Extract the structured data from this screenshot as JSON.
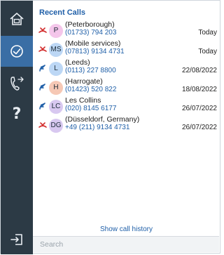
{
  "rail": {
    "items": [
      {
        "icon": "home-icon"
      },
      {
        "icon": "recent-calls-clock-icon",
        "active": true
      },
      {
        "icon": "transfer-phone-icon"
      },
      {
        "icon": "help-icon",
        "label": "?"
      },
      {
        "icon": "logout-icon"
      }
    ]
  },
  "recent": {
    "title": "Recent Calls",
    "calls": [
      {
        "direction": "missed",
        "initials": "P",
        "avatar_color": "#f4c6ea",
        "name": "(Peterborough)",
        "number": "(01733) 794 203",
        "date": "Today"
      },
      {
        "direction": "missed",
        "initials": "MS",
        "avatar_color": "#bcd7f5",
        "name": "(Mobile services)",
        "number": "(07813) 9134 4731",
        "date": "Today"
      },
      {
        "direction": "incoming",
        "initials": "L",
        "avatar_color": "#bcd7f5",
        "name": "(Leeds)",
        "number": "(0113) 227 8800",
        "date": "22/08/2022"
      },
      {
        "direction": "incoming",
        "initials": "H",
        "avatar_color": "#f6c8b5",
        "name": "(Harrogate)",
        "number": "(01423) 520 822",
        "date": "18/08/2022"
      },
      {
        "direction": "incoming",
        "initials": "LC",
        "avatar_color": "#d8c8f0",
        "name": "Les Collins",
        "number": "(020) 8145 6177",
        "date": "26/07/2022"
      },
      {
        "direction": "missed",
        "initials": "DG",
        "avatar_color": "#d8c8f0",
        "name": "(Düsseldorf, Germany)",
        "number": "+49 (211) 9134 4731",
        "date": "26/07/2022"
      }
    ],
    "history_link": "Show call history"
  },
  "search": {
    "placeholder": "Search",
    "value": ""
  },
  "colors": {
    "rail_bg": "#2c3a45",
    "rail_active": "#3a6ea5",
    "link_blue": "#1f5fa8",
    "missed_red": "#d32f2f",
    "incoming_blue": "#1f5fa8"
  }
}
